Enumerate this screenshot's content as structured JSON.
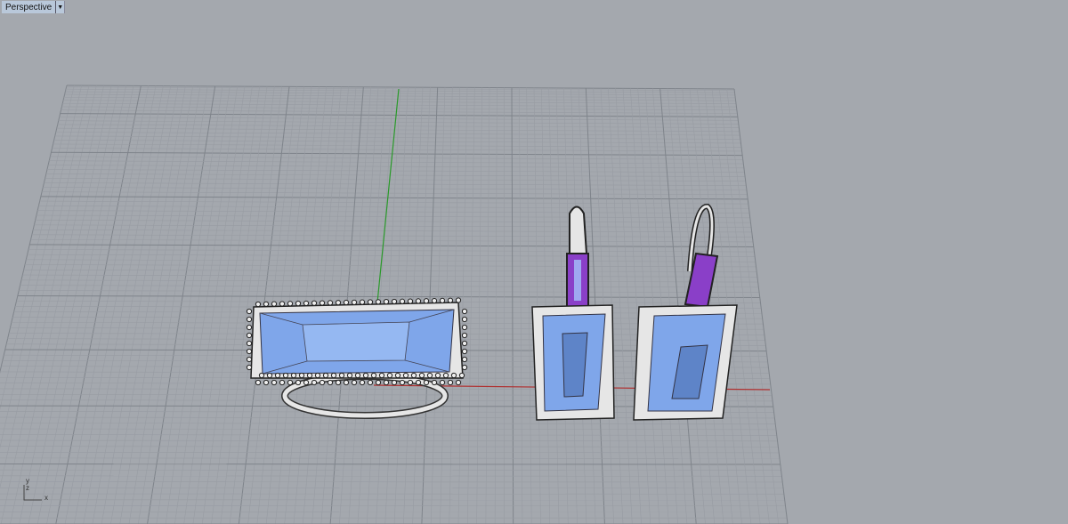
{
  "viewport": {
    "title": "Perspective",
    "menu_icon": "triangle-down-icon"
  },
  "axes": {
    "x": "x",
    "y": "y",
    "z": "z"
  },
  "colors": {
    "background": "#a4a8ae",
    "grid_minor": "#989ca3",
    "grid_major": "#7f848b",
    "x_axis": "#b03030",
    "y_axis": "#2a9a2a",
    "gem": "#7fa6ea",
    "metal": "#e6e6e6",
    "amethyst": "#8a3fc8"
  }
}
